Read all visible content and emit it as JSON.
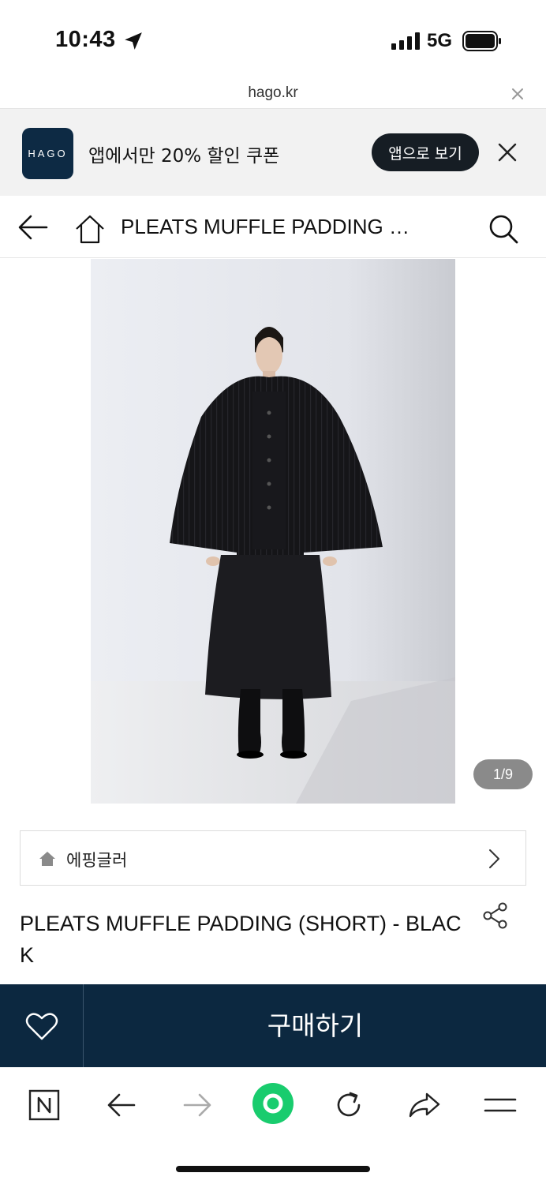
{
  "status": {
    "time": "10:43",
    "network": "5G",
    "icons": [
      "location-arrow-icon",
      "signal-bars-icon",
      "battery-icon"
    ]
  },
  "browser": {
    "url": "hago.kr"
  },
  "app_banner": {
    "logo_text": "HAGO",
    "message": "앱에서만 20% 할인 쿠폰",
    "open_app_label": "앱으로 보기"
  },
  "nav": {
    "title": "PLEATS MUFFLE PADDING …"
  },
  "gallery": {
    "counter": "1/9",
    "colors": {
      "background": "#e6e8ee",
      "garment": "#151518"
    }
  },
  "brand": {
    "name": "에핑글러"
  },
  "product": {
    "title": "PLEATS MUFFLE PADDING (SHORT) - BLACK"
  },
  "purchase": {
    "buy_label": "구매하기",
    "colors": {
      "bar": "#0c2840"
    }
  },
  "toolbar": {
    "icons": [
      "naver-n-icon",
      "back-arrow-icon",
      "forward-arrow-icon",
      "green-dot-icon",
      "reload-icon",
      "share-arrow-icon",
      "menu-icon"
    ],
    "colors": {
      "green": "#19cc6e"
    }
  }
}
